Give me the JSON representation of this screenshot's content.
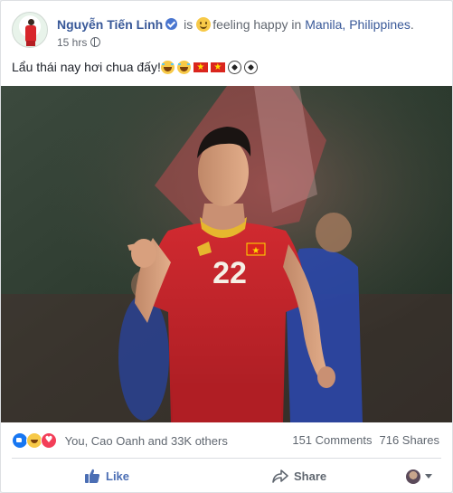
{
  "post": {
    "author": "Nguyễn Tiến Linh",
    "verb": "is",
    "feeling": "feeling happy in",
    "location": "Manila, Philippines",
    "location_suffix": ".",
    "timestamp": "15 hrs",
    "privacy_icon": "globe-icon",
    "text": "Lẩu thái nay hơi chua đấy!",
    "text_emojis": [
      "rofl",
      "rofl",
      "vietnam-flag",
      "vietnam-flag",
      "soccer-ball",
      "soccer-ball"
    ]
  },
  "photo": {
    "jersey_number": "22",
    "colors": {
      "jersey": "#c8242b",
      "opponent": "#2745a8",
      "background": "#2e3a30"
    }
  },
  "stats": {
    "reaction_icons": [
      "like-icon",
      "haha-icon",
      "love-icon"
    ],
    "reactions_text": "You, Cao Oanh and 33K others",
    "comments": "151 Comments",
    "shares": "716 Shares"
  },
  "actions": {
    "like_label": "Like",
    "share_label": "Share"
  },
  "colors": {
    "link": "#385898",
    "like_active": "#4b6eb4",
    "muted": "#606770"
  }
}
